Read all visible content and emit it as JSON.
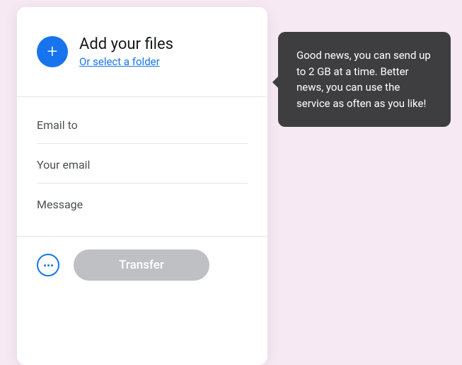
{
  "upload": {
    "title": "Add your files",
    "folder_link": "Or select a folder"
  },
  "fields": {
    "email_to_placeholder": "Email to",
    "your_email_placeholder": "Your email",
    "message_placeholder": "Message"
  },
  "footer": {
    "transfer_label": "Transfer"
  },
  "tooltip": {
    "text": "Good news, you can send up to 2 GB at a time. Better news, you can use the service as often as you like!"
  },
  "colors": {
    "accent": "#1774ec",
    "disabled": "#bfc0c3",
    "tooltip_bg": "#3e3e40"
  }
}
